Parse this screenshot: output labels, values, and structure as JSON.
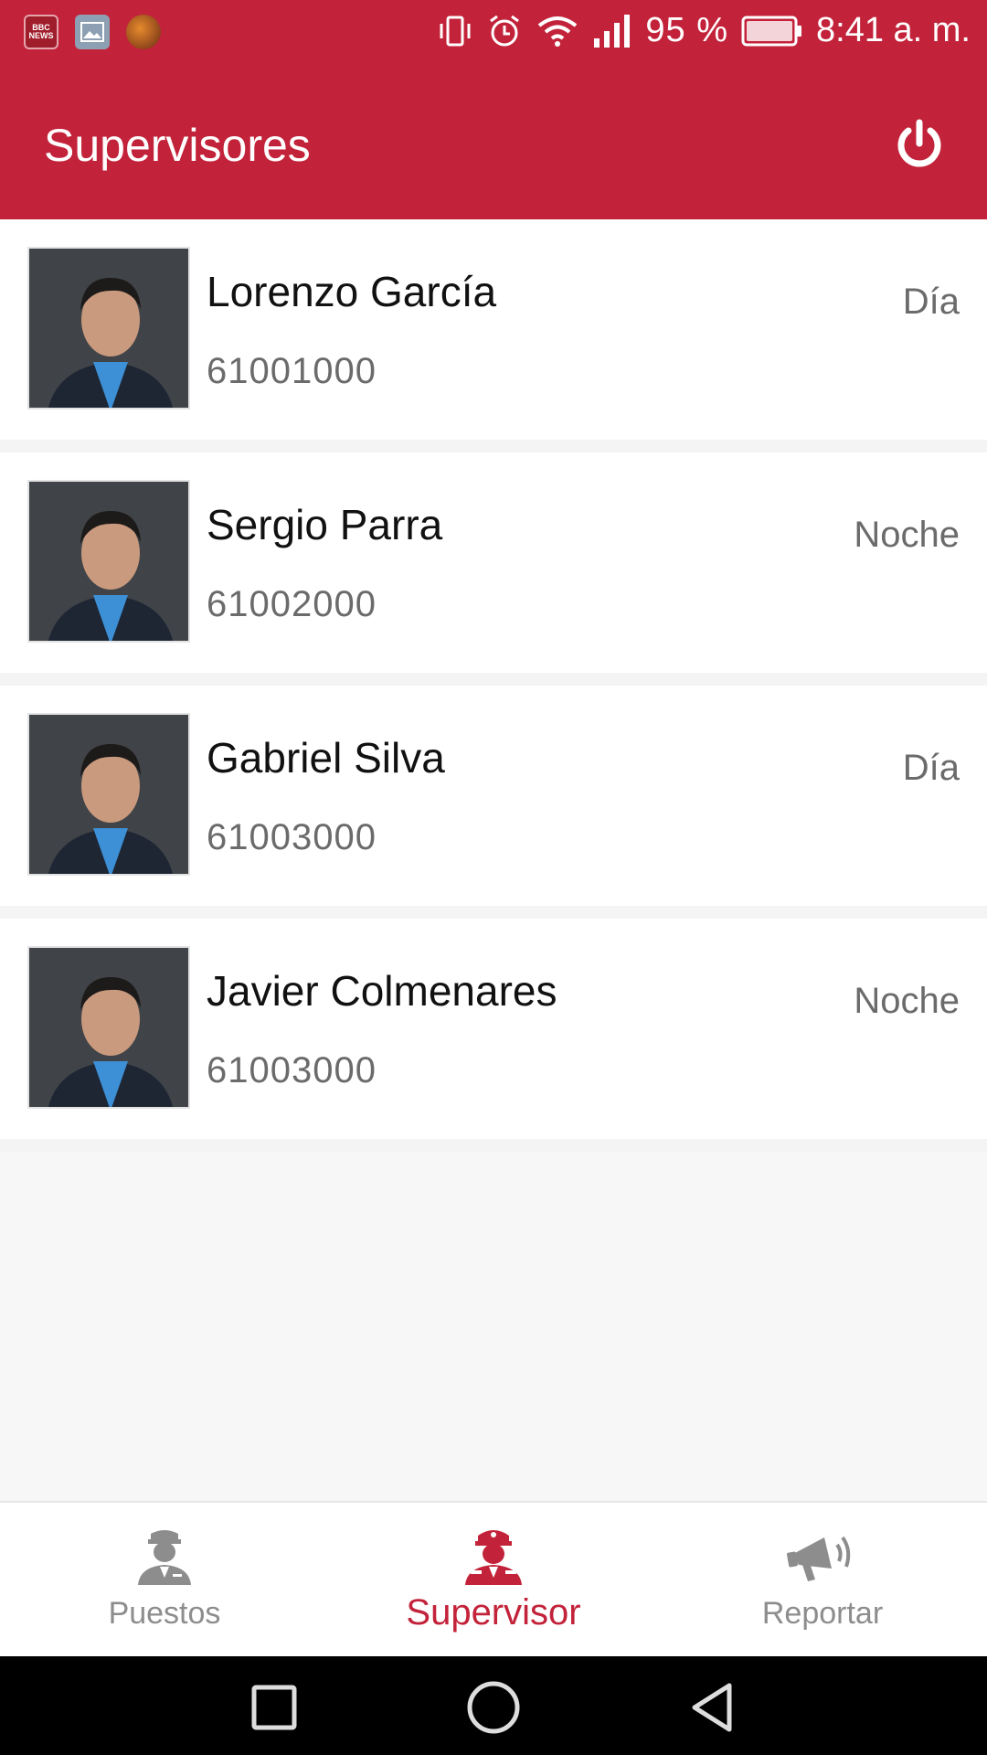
{
  "status_bar": {
    "notification_icons": [
      "bbc-news-icon",
      "gallery-icon",
      "avatar-icon"
    ],
    "notification_bbc_text": "BBC NEWS",
    "battery_percent": "95 %",
    "time": "8:41 a. m."
  },
  "toolbar": {
    "title": "Supervisores",
    "power_icon": "power-icon"
  },
  "supervisors": [
    {
      "name": "Lorenzo García",
      "phone": "61001000",
      "shift": "Día"
    },
    {
      "name": "Sergio Parra",
      "phone": "61002000",
      "shift": "Noche"
    },
    {
      "name": "Gabriel Silva",
      "phone": "61003000",
      "shift": "Día"
    },
    {
      "name": "Javier Colmenares",
      "phone": "61003000",
      "shift": "Noche"
    }
  ],
  "bottom_nav": {
    "items": [
      {
        "label": "Puestos",
        "icon": "guard-icon",
        "active": false
      },
      {
        "label": "Supervisor",
        "icon": "supervisor-icon",
        "active": true
      },
      {
        "label": "Reportar",
        "icon": "megaphone-icon",
        "active": false
      }
    ]
  },
  "colors": {
    "brand": "#c3233a",
    "inactive": "#8d8d8d",
    "text_secondary": "#6b6b6b"
  }
}
